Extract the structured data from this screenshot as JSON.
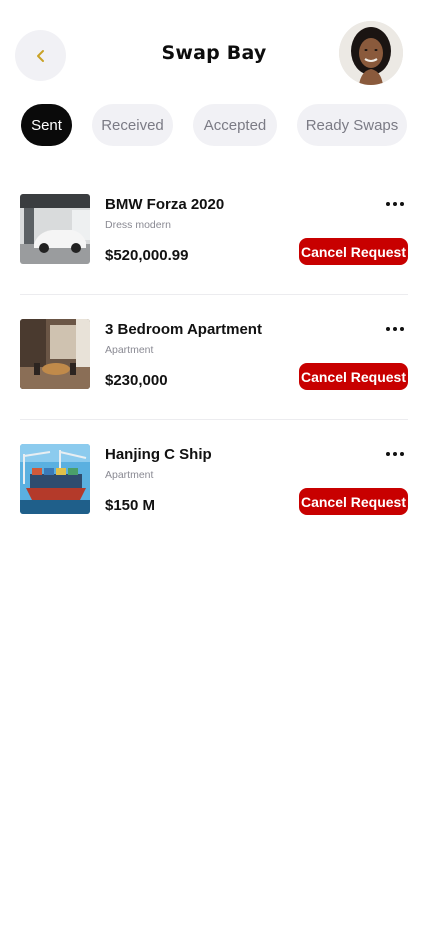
{
  "header": {
    "title": "Swap Bay",
    "back_icon": "chevron-left-icon",
    "accent_color": "#c9a227"
  },
  "tabs": [
    {
      "label": "Sent",
      "active": true
    },
    {
      "label": "Received",
      "active": false
    },
    {
      "label": "Accepted",
      "active": false
    },
    {
      "label": "Ready Swaps",
      "active": false
    }
  ],
  "requests": [
    {
      "title": "BMW Forza 2020",
      "subtitle": "Dress modern",
      "price": "$520,000.99",
      "action": "Cancel Request",
      "thumb": "car-photo"
    },
    {
      "title": "3 Bedroom Apartment",
      "subtitle": "Apartment",
      "price": "$230,000",
      "action": "Cancel Request",
      "thumb": "apartment-photo"
    },
    {
      "title": "Hanjing C Ship",
      "subtitle": "Apartment",
      "price": "$150 M",
      "action": "Cancel Request",
      "thumb": "ship-photo"
    }
  ],
  "colors": {
    "cancel": "#c80000",
    "tab_active": "#0a0a0a",
    "tab_inactive": "#f1f1f5"
  }
}
